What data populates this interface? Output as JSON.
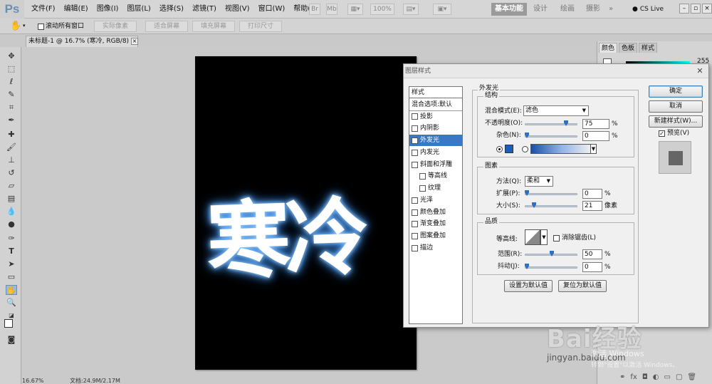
{
  "app": {
    "logo": "Ps"
  },
  "menubar": {
    "menus": [
      "文件(F)",
      "编辑(E)",
      "图像(I)",
      "图层(L)",
      "选择(S)",
      "滤镜(T)",
      "视图(V)",
      "窗口(W)",
      "帮助(H)"
    ],
    "zoom": "100%",
    "workspaces": [
      "基本功能",
      "设计",
      "绘画",
      "摄影"
    ],
    "more": "»",
    "cslive": "CS Live"
  },
  "options": {
    "scroll_all": "滚动所有窗口",
    "buttons": [
      "实际像素",
      "适合屏幕",
      "填充屏幕",
      "打印尺寸"
    ]
  },
  "document": {
    "tab_title": "未标题-1 @ 16.7% (寒冷, RGB/8) *",
    "art_text": "寒冷",
    "glow_color": "#5aa8ff"
  },
  "statusbar": {
    "zoom": "16.67%",
    "doc_info": "文档:24.9M/2.17M"
  },
  "right_panel": {
    "tabs": [
      "颜色",
      "色板",
      "样式"
    ],
    "value": "255"
  },
  "dialog": {
    "title": "图层样式",
    "styles_header": "样式",
    "style_items": [
      {
        "label": "混合选项:默认",
        "checked": false
      },
      {
        "label": "投影",
        "checked": false
      },
      {
        "label": "内阴影",
        "checked": false
      },
      {
        "label": "外发光",
        "checked": true
      },
      {
        "label": "内发光",
        "checked": false
      },
      {
        "label": "斜面和浮雕",
        "checked": false
      },
      {
        "label": "等高线",
        "checked": false
      },
      {
        "label": "纹理",
        "checked": false
      },
      {
        "label": "光泽",
        "checked": false
      },
      {
        "label": "颜色叠加",
        "checked": false
      },
      {
        "label": "渐变叠加",
        "checked": false
      },
      {
        "label": "图案叠加",
        "checked": false
      },
      {
        "label": "描边",
        "checked": false
      }
    ],
    "outer_glow": {
      "section": "外发光",
      "structure": {
        "title": "结构",
        "blend_mode_label": "混合模式(E):",
        "blend_mode": "滤色",
        "opacity_label": "不透明度(O):",
        "opacity": "75",
        "noise_label": "杂色(N):",
        "noise": "0",
        "percent": "%",
        "glow_color": "#1a5fb4"
      },
      "elements": {
        "title": "图素",
        "technique_label": "方法(Q):",
        "technique": "柔和",
        "spread_label": "扩展(P):",
        "spread": "0",
        "size_label": "大小(S):",
        "size": "21",
        "size_unit": "像素",
        "percent": "%"
      },
      "quality": {
        "title": "品质",
        "contour_label": "等高线:",
        "antialias_label": "消除锯齿(L)",
        "range_label": "范围(R):",
        "range": "50",
        "jitter_label": "抖动(J):",
        "jitter": "0",
        "percent": "%"
      },
      "make_default": "设置为默认值",
      "reset_default": "复位为默认值"
    },
    "buttons": {
      "ok": "确定",
      "cancel": "取消",
      "new_style": "新建样式(W)...",
      "preview": "预览(V)"
    }
  },
  "watermark": {
    "brand": "Bai经验",
    "site": "jingyan.baidu.com"
  },
  "windows_activation": {
    "line1": "激活 Windows",
    "line2": "转到\"设置\"以激活 Windows。"
  }
}
